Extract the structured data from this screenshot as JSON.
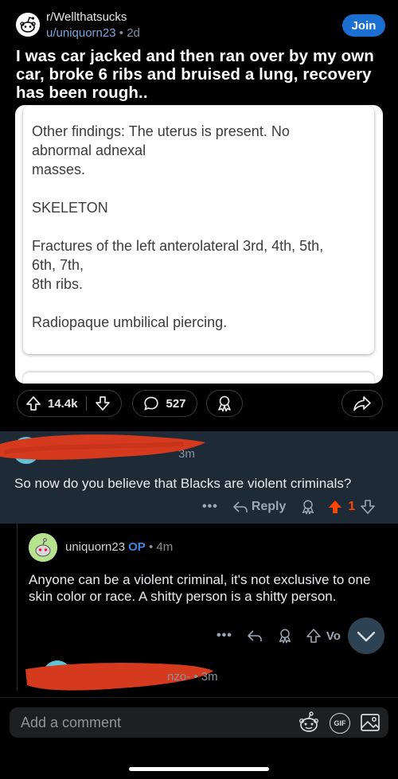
{
  "post": {
    "subreddit": "r/Wellthatsucks",
    "author": "u/uniquorn23",
    "separator": "•",
    "age": "2d",
    "join_label": "Join",
    "title": "I was car jacked and then ran over by my own car, broke 6 ribs and bruised a lung, recovery has been rough..",
    "image_text": {
      "p1": "Other findings: The uterus is present. No\nabnormal adnexal\nmasses.",
      "p2": "SKELETON",
      "p3": "Fractures of the left anterolateral 3rd, 4th, 5th,\n6th, 7th,\n8th ribs.",
      "p4": "Radiopaque umbilical piercing."
    },
    "upvotes": "14.4k",
    "comments": "527"
  },
  "comments": [
    {
      "time_fragment": "3m",
      "text": "So now do you believe that Blacks are violent criminals?",
      "reply_label": "Reply",
      "score": "1"
    },
    {
      "username": "uniquorn23",
      "op_badge": "OP",
      "separator": "•",
      "age": "4m",
      "text": "Anyone can be a violent criminal, it's not exclusive to one skin color or race. A shitty person is a shitty person.",
      "vote_fragment": "Vo"
    },
    {
      "name_fragment": "nzo-",
      "separator": "•",
      "age": "3m"
    }
  ],
  "composer": {
    "placeholder": "Add a comment",
    "gif_label": "GIF"
  },
  "colors": {
    "join": "#1a6fd0",
    "upvote_active": "#ff4500",
    "op": "#3d86e0",
    "highlight_bg": "#1f2a37",
    "redaction": "#d63a1e"
  }
}
